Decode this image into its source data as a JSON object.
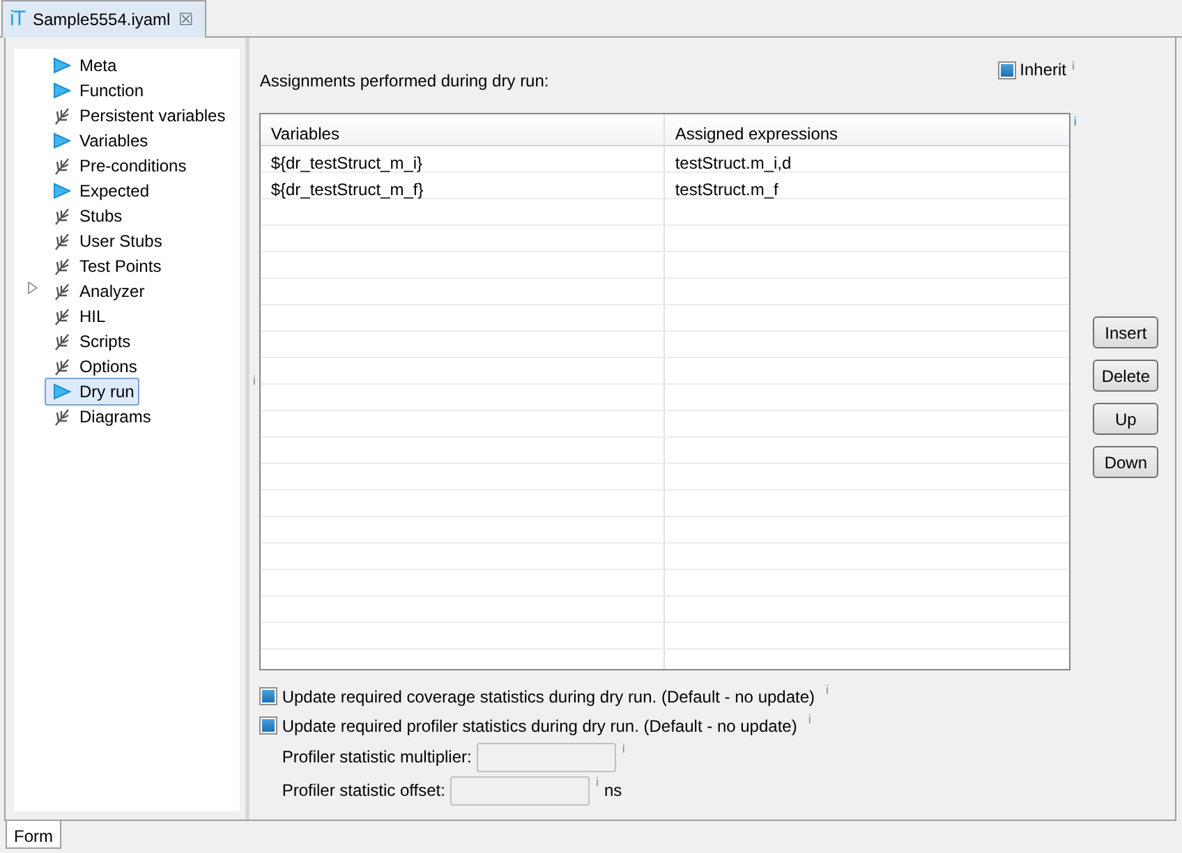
{
  "editor_tab": {
    "logo": "iT",
    "title": "Sample5554.iyaml",
    "close": "☒"
  },
  "tree": [
    {
      "label": "Meta",
      "kind": "run",
      "selected": false,
      "expandable": false
    },
    {
      "label": "Function",
      "kind": "run",
      "selected": false,
      "expandable": false
    },
    {
      "label": "Persistent variables",
      "kind": "leaf",
      "selected": false,
      "expandable": false
    },
    {
      "label": "Variables",
      "kind": "run",
      "selected": false,
      "expandable": false
    },
    {
      "label": "Pre-conditions",
      "kind": "leaf",
      "selected": false,
      "expandable": false
    },
    {
      "label": "Expected",
      "kind": "run",
      "selected": false,
      "expandable": false
    },
    {
      "label": "Stubs",
      "kind": "leaf",
      "selected": false,
      "expandable": false
    },
    {
      "label": "User Stubs",
      "kind": "leaf",
      "selected": false,
      "expandable": false
    },
    {
      "label": "Test Points",
      "kind": "leaf",
      "selected": false,
      "expandable": false
    },
    {
      "label": "Analyzer",
      "kind": "leaf",
      "selected": false,
      "expandable": true
    },
    {
      "label": "HIL",
      "kind": "leaf",
      "selected": false,
      "expandable": false
    },
    {
      "label": "Scripts",
      "kind": "leaf",
      "selected": false,
      "expandable": false
    },
    {
      "label": "Options",
      "kind": "leaf",
      "selected": false,
      "expandable": false
    },
    {
      "label": "Dry run",
      "kind": "run",
      "selected": true,
      "expandable": false
    },
    {
      "label": "Diagrams",
      "kind": "leaf",
      "selected": false,
      "expandable": false
    }
  ],
  "sash_info": "i",
  "heading": "Assignments performed during dry run:",
  "inherit": {
    "label": "Inherit",
    "checked": true,
    "info": "i"
  },
  "table": {
    "info": "i",
    "columns": [
      "Variables",
      "Assigned expressions"
    ],
    "rows": [
      [
        "${dr_testStruct_m_i}",
        "testStruct.m_i,d"
      ],
      [
        "${dr_testStruct_m_f}",
        "testStruct.m_f"
      ]
    ]
  },
  "buttons": [
    "Insert",
    "Delete",
    "Up",
    "Down"
  ],
  "options": [
    {
      "label": "Update required coverage statistics during dry run. (Default - no update)",
      "checked": true,
      "info": "i"
    },
    {
      "label": "Update required profiler statistics during dry run. (Default - no update)",
      "checked": true,
      "info": "i"
    }
  ],
  "fields": [
    {
      "label": "Profiler statistic multiplier:",
      "info": "i"
    },
    {
      "label": "Profiler statistic offset:",
      "info": "i",
      "unit": "ns"
    }
  ],
  "bottom_tab": "Form"
}
